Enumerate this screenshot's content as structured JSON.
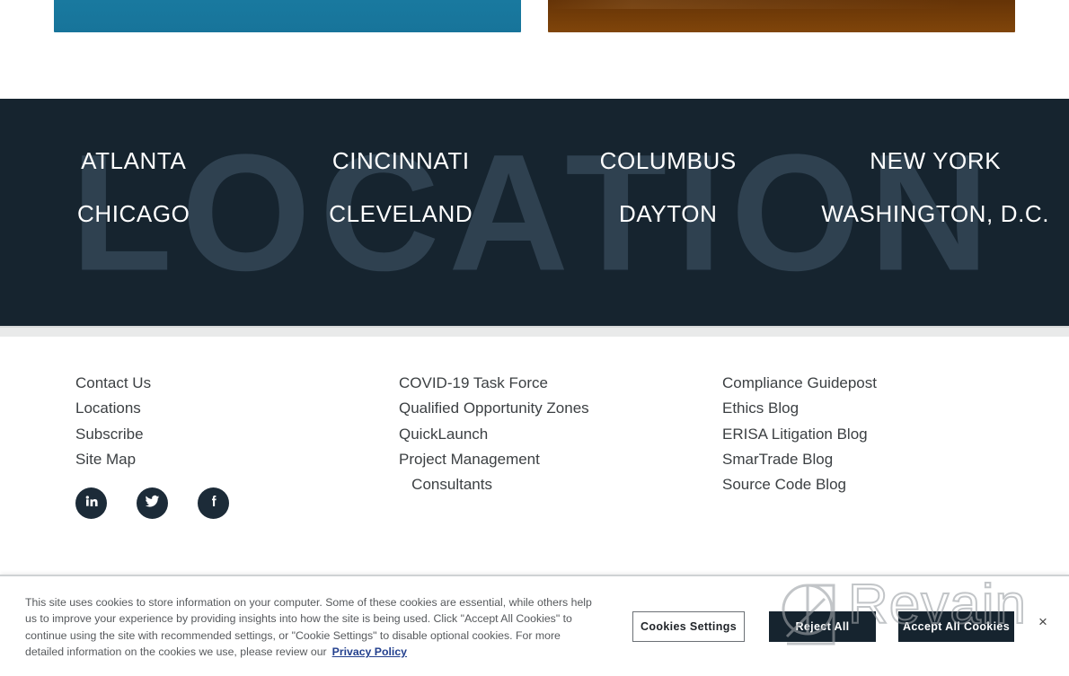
{
  "top_cards": {
    "left_card": {
      "name": "teal-image-card"
    },
    "right_card": {
      "name": "brown-image-card"
    }
  },
  "locations": {
    "watermark": "LOCATION",
    "background_color": "#16242f",
    "watermark_color": "#2f4150",
    "items": [
      "ATLANTA",
      "CINCINNATI",
      "COLUMBUS",
      "NEW YORK",
      "CHICAGO",
      "CLEVELAND",
      "DAYTON",
      "WASHINGTON, D.C."
    ]
  },
  "footer": {
    "column_1": [
      "Contact Us",
      "Locations",
      "Subscribe",
      "Site Map"
    ],
    "column_2": [
      "COVID-19 Task Force",
      "Qualified Opportunity Zones",
      "QuickLaunch",
      "Project Management\n   Consultants"
    ],
    "column_3": [
      "Compliance Guidepost",
      "Ethics Blog",
      "ERISA Litigation Blog",
      "SmarTrade Blog",
      "Source Code Blog"
    ],
    "social": [
      {
        "name": "linkedin-icon",
        "label": "LinkedIn"
      },
      {
        "name": "twitter-icon",
        "label": "Twitter"
      },
      {
        "name": "facebook-icon",
        "label": "Facebook"
      }
    ],
    "social_color": "#1c2b38"
  },
  "cookie_banner": {
    "text": "This site uses cookies to store information on your computer. Some of these cookies are essential, while others help us to improve your experience by providing insights into how the site is being used. Click \"Accept All Cookies\" to continue using the site with recommended settings, or \"Cookie Settings\" to disable optional cookies. For more detailed information on the cookies we use, please review our",
    "privacy_link": "Privacy Policy",
    "privacy_link_color": "#23408e",
    "buttons": {
      "settings": "Cookies Settings",
      "reject": "Reject All",
      "accept": "Accept All Cookies"
    },
    "close_label": "×",
    "accent_color": "#16242f"
  },
  "watermark_overlay": {
    "text": "Revain",
    "color": "#9ea3a7"
  }
}
